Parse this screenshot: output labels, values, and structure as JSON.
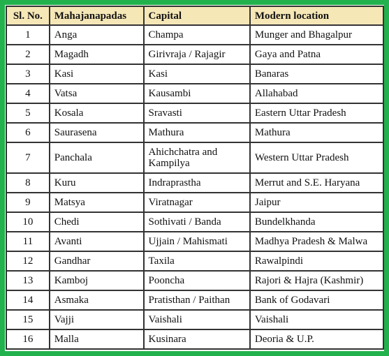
{
  "colors": {
    "border": "#22b14c",
    "header_bg": "#f6e7b7"
  },
  "headers": [
    "Sl. No.",
    "Mahajanapadas",
    "Capital",
    "Modern location"
  ],
  "rows": [
    [
      "1",
      "Anga",
      "Champa",
      "Munger and Bhagalpur"
    ],
    [
      "2",
      "Magadh",
      "Girivraja / Rajagir",
      "Gaya and Patna"
    ],
    [
      "3",
      "Kasi",
      "Kasi",
      "Banaras"
    ],
    [
      "4",
      "Vatsa",
      "Kausambi",
      "Allahabad"
    ],
    [
      "5",
      "Kosala",
      "Sravasti",
      "Eastern Uttar Pradesh"
    ],
    [
      "6",
      "Saurasena",
      "Mathura",
      "Mathura"
    ],
    [
      "7",
      "Panchala",
      "Ahichchatra and Kampilya",
      "Western Uttar Pradesh"
    ],
    [
      "8",
      "Kuru",
      "Indraprastha",
      "Merrut and S.E. Haryana"
    ],
    [
      "9",
      "Matsya",
      "Viratnagar",
      "Jaipur"
    ],
    [
      "10",
      "Chedi",
      "Sothivati / Banda",
      "Bundelkhanda"
    ],
    [
      "11",
      "Avanti",
      "Ujjain / Mahismati",
      "Madhya Pradesh & Malwa"
    ],
    [
      "12",
      "Gandhar",
      "Taxila",
      "Rawalpindi"
    ],
    [
      "13",
      "Kamboj",
      "Pooncha",
      "Rajori & Hajra (Kashmir)"
    ],
    [
      "14",
      "Asmaka",
      "Pratisthan / Paithan",
      "Bank of Godavari"
    ],
    [
      "15",
      "Vajji",
      "Vaishali",
      "Vaishali"
    ],
    [
      "16",
      "Malla",
      "Kusinara",
      "Deoria & U.P."
    ]
  ]
}
